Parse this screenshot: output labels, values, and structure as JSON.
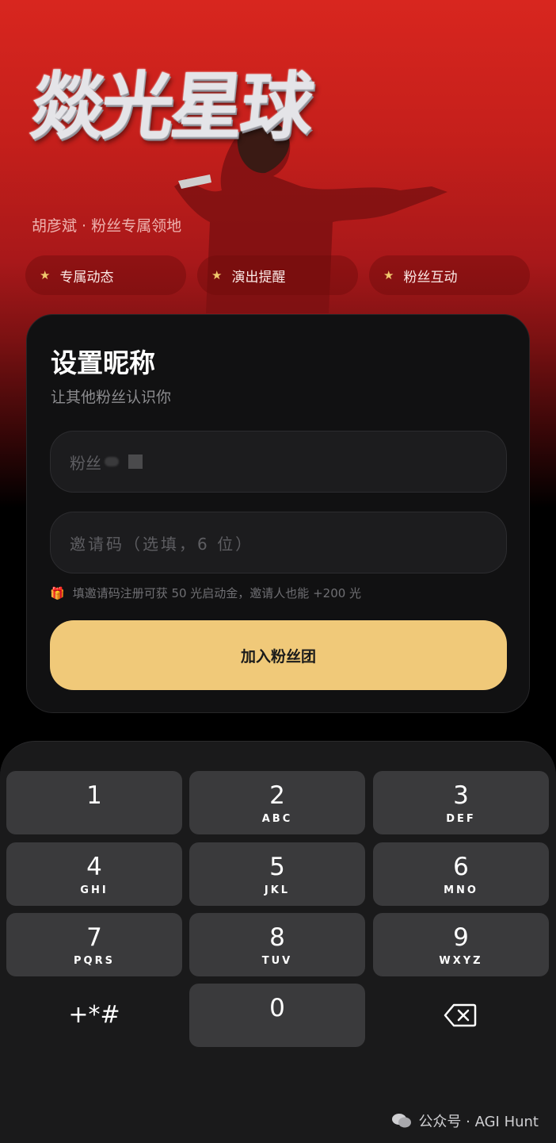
{
  "hero": {
    "logo_text": "燚光星球",
    "subtitle": "胡彦斌 · 粉丝专属领地",
    "tags": [
      "专属动态",
      "演出提醒",
      "粉丝互动"
    ]
  },
  "form": {
    "title": "设置昵称",
    "subtitle": "让其他粉丝认识你",
    "nickname_value": "粉丝",
    "invite_placeholder": "邀请码（选填，6 位）",
    "hint": "填邀请码注册可获 50 光启动金，邀请人也能 +200 光",
    "submit_label": "加入粉丝团"
  },
  "keypad": {
    "keys": [
      {
        "digit": "1",
        "letters": ""
      },
      {
        "digit": "2",
        "letters": "ABC"
      },
      {
        "digit": "3",
        "letters": "DEF"
      },
      {
        "digit": "4",
        "letters": "GHI"
      },
      {
        "digit": "5",
        "letters": "JKL"
      },
      {
        "digit": "6",
        "letters": "MNO"
      },
      {
        "digit": "7",
        "letters": "PQRS"
      },
      {
        "digit": "8",
        "letters": "TUV"
      },
      {
        "digit": "9",
        "letters": "WXYZ"
      },
      {
        "digit": "0",
        "letters": ""
      }
    ],
    "symbols_label": "+*#",
    "delete_icon": "backspace-icon"
  },
  "watermark": "公众号 · AGI Hunt",
  "colors": {
    "hero_red": "#d8261f",
    "accent_gold": "#f0c979",
    "card_bg": "#111112",
    "key_bg": "#3a3a3c"
  }
}
